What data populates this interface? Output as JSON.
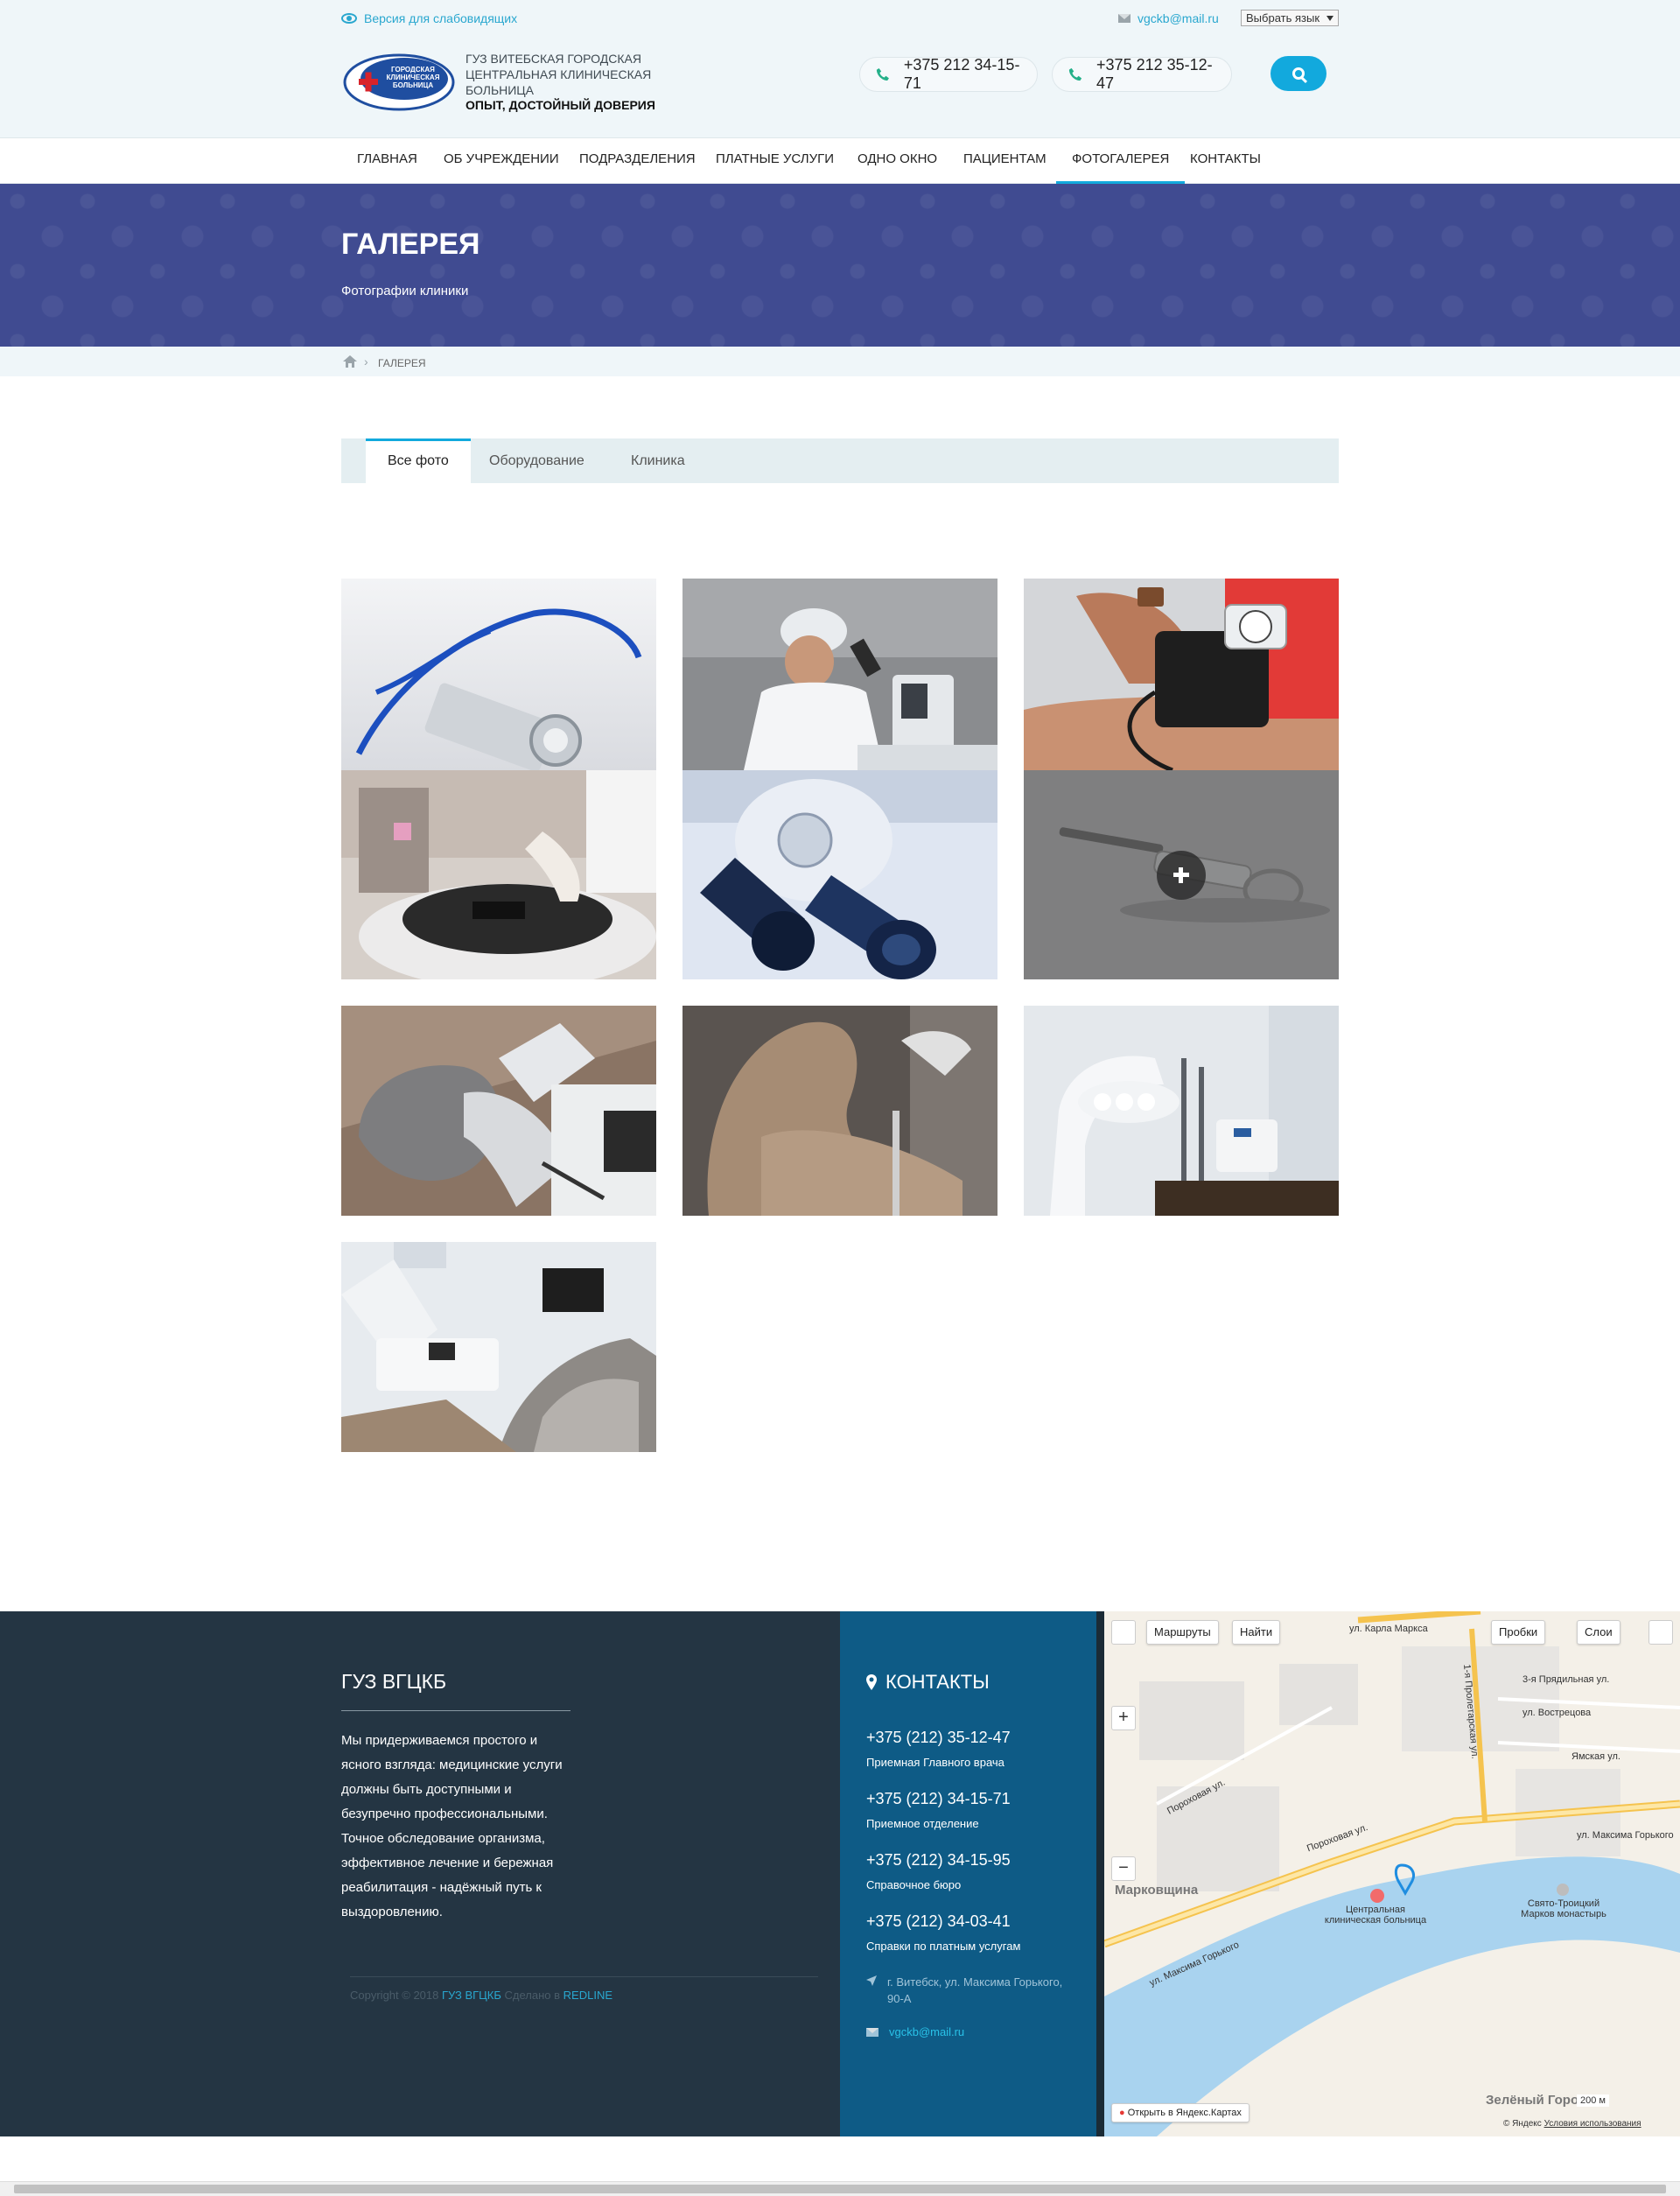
{
  "header": {
    "low_vision_link": "Версия для слабовидящих",
    "email": "vgckb@mail.ru",
    "language_select": "Выбрать язык",
    "org_name": "ГУЗ ВИТЕБСКАЯ ГОРОДСКАЯ ЦЕНТРАЛЬНАЯ КЛИНИЧЕСКАЯ БОЛЬНИЦА",
    "org_slogan": "ОПЫТ, ДОСТОЙНЫЙ ДОВЕРИЯ",
    "logo_text": [
      "ГОРОДСКАЯ",
      "КЛИНИЧЕСКАЯ",
      "БОЛЬНИЦА"
    ],
    "phones": [
      "+375 212 34-15-71",
      "+375 212 35-12-47"
    ]
  },
  "nav": {
    "items": [
      "ГЛАВНАЯ",
      "ОБ УЧРЕЖДЕНИИ",
      "ПОДРАЗДЕЛЕНИЯ",
      "ПЛАТНЫЕ УСЛУГИ",
      "ОДНО ОКНО",
      "ПАЦИЕНТАМ",
      "ФОТОГАЛЕРЕЯ",
      "КОНТАКТЫ"
    ],
    "active": "ФОТОГАЛЕРЕЯ"
  },
  "banner": {
    "title": "ГАЛЕРЕЯ",
    "subtitle": "Фотографии клиники"
  },
  "breadcrumb": {
    "current": "ГАЛЕРЕЯ"
  },
  "tabs": {
    "items": [
      "Все фото",
      "Оборудование",
      "Клиника"
    ],
    "active": "Все фото"
  },
  "gallery": {
    "photos": [
      "stethoscope-icon",
      "microscope-scientist",
      "blood-pressure-monitor",
      "lab-centrifuge",
      "microscope-eyepieces",
      "syringe",
      "dental-chair-top",
      "dental-chair-beige",
      "dental-lamp",
      "dental-office"
    ]
  },
  "footer": {
    "title": "ГУЗ ВГЦКБ",
    "about": "Мы придерживаемся простого и ясного взгляда: медицинские услуги должны быть доступными и безупречно профессиональными. Точное обследование организма, эффективное лечение и бережная реабилитация - надёжный путь к выздоровлению.",
    "copyright_prefix": "Copyright © 2018",
    "copyright_org": "ГУЗ ВГЦКБ",
    "made_by": "Сделано в",
    "made_by_company": "REDLINE"
  },
  "contacts": {
    "title": "КОНТАКТЫ",
    "items": [
      {
        "phone": "+375 (212) 35-12-47",
        "label": "Приемная Главного врача"
      },
      {
        "phone": "+375 (212) 34-15-71",
        "label": "Приемное отделение"
      },
      {
        "phone": "+375 (212) 34-15-95",
        "label": "Справочное бюро"
      },
      {
        "phone": "+375 (212) 34-03-41",
        "label": "Справки по платным услугам"
      }
    ],
    "address": "г. Витебск, ул. Максима Горького, 90-А",
    "email": "vgckb@mail.ru"
  },
  "map": {
    "routes_button": "Маршруты",
    "find_button": "Найти",
    "traffic_button": "Пробки",
    "layers_button": "Слои",
    "open_in_yandex": "Открыть в Яндекс.Картах",
    "scale": "200 м",
    "copyright": "© Яндекс",
    "terms": "Условия использования",
    "labels": [
      "ул. Карла Маркса",
      "1-я Пролетарская ул.",
      "3-я Прядильная ул.",
      "ул. Вострецова",
      "Ямская ул.",
      "Пороховая ул.",
      "Пороховая ул.",
      "ул. Максима Горького",
      "Марковщина",
      "Центральная клиническая больница",
      "Свято-Троицкий Марков монастырь",
      "ул. Максима Горького",
      "Зелёный Город"
    ]
  },
  "colors": {
    "accent": "#12a9dd",
    "banner": "#404b91",
    "footer_dark": "#243543",
    "footer_blue": "#0e5b86"
  }
}
